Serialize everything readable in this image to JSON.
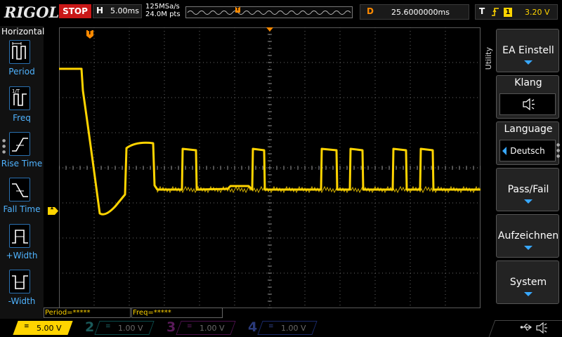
{
  "topbar": {
    "brand": "RIGOL",
    "run_state": "STOP",
    "timebase_label": "H",
    "timebase_value": "5.00ms",
    "sample_rate": "125MSa/s",
    "memory_depth": "24.0M pts",
    "trigger_marker": "T",
    "delay_label": "D",
    "delay_value": "25.6000000ms",
    "trigger_label": "T",
    "trigger_edge_icon": "rising-edge-icon",
    "trigger_source": "1",
    "trigger_level": "3.20 V"
  },
  "colors": {
    "ch1": "#ffd400",
    "ch2": "#00c3c3",
    "ch3": "#e000e0",
    "ch4": "#3a6bff",
    "trigger": "#ff8a00",
    "accent": "#38a8ff",
    "stop": "#c91818"
  },
  "left_panel": {
    "title": "Horizontal",
    "items": [
      {
        "label": "Period",
        "icon": "period-measure-icon"
      },
      {
        "label": "Freq",
        "icon": "frequency-measure-icon"
      },
      {
        "label": "Rise Time",
        "icon": "rise-time-icon"
      },
      {
        "label": "Fall Time",
        "icon": "fall-time-icon"
      },
      {
        "label": "+Width",
        "icon": "positive-width-icon"
      },
      {
        "label": "-Width",
        "icon": "negative-width-icon"
      }
    ]
  },
  "scope": {
    "trigger_marker_top": "T",
    "trigger_level_marker": "T",
    "channel_ground_marker": "1",
    "grid_divisions": {
      "horizontal": 12,
      "vertical": 8
    }
  },
  "right_menu": {
    "title": "Utility",
    "buttons": [
      {
        "label": "EA Einstell"
      },
      {
        "label": "Klang",
        "value_icon": "speaker-icon"
      },
      {
        "label": "Language",
        "value": "Deutsch"
      },
      {
        "label": "Pass/Fail"
      },
      {
        "label": "Aufzeichnen"
      },
      {
        "label": "System"
      }
    ]
  },
  "measurements": {
    "period": "Period=*****",
    "freq": "Freq=*****"
  },
  "channels": [
    {
      "num": "1",
      "coupling": "≡",
      "volts": "5.00 V",
      "active": true
    },
    {
      "num": "2",
      "coupling": "≡",
      "volts": "1.00 V",
      "active": false
    },
    {
      "num": "3",
      "coupling": "≡",
      "volts": "1.00 V",
      "active": false
    },
    {
      "num": "4",
      "coupling": "≡",
      "volts": "1.00 V",
      "active": false
    }
  ],
  "status_icons": {
    "usb": "usb-icon",
    "sound": "speaker-icon"
  }
}
